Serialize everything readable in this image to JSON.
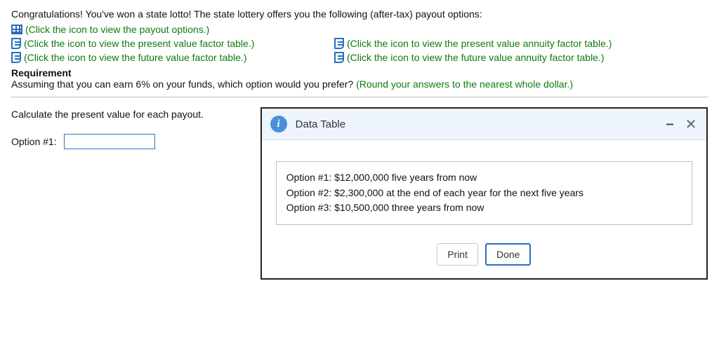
{
  "intro": "Congratulations! You've won a state lotto! The state lottery offers you the following (after-tax) payout options:",
  "links": {
    "payout": "(Click the icon to view the payout options.)",
    "pv_factor": "(Click the icon to view the present value factor table.)",
    "pv_annuity": "(Click the icon to view the present value annuity factor table.)",
    "fv_factor": "(Click the icon to view the future value factor table.)",
    "fv_annuity": "(Click the icon to view the future value annuity factor table.)"
  },
  "requirement": {
    "label": "Requirement",
    "text": "Assuming that you can earn 6% on your funds, which option would you prefer? ",
    "hint": "(Round your answers to the nearest whole dollar.)"
  },
  "calc": {
    "prompt": "Calculate the present value for each payout.",
    "option1_label": "Option #1:",
    "option1_value": ""
  },
  "modal": {
    "title": "Data Table",
    "rows": [
      "Option #1: $12,000,000 five years from now",
      "Option #2: $2,300,000 at the end of each year for the next five years",
      "Option #3: $10,500,000 three years from now"
    ],
    "print": "Print",
    "done": "Done"
  }
}
